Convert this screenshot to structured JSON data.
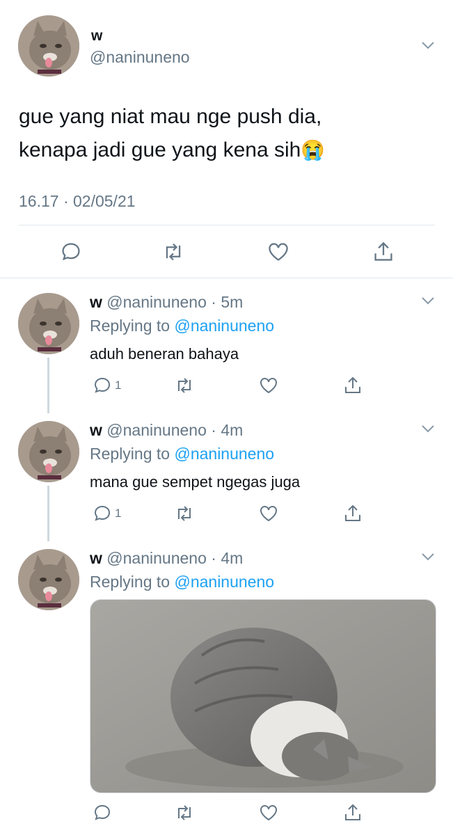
{
  "main_tweet": {
    "display_name": "w",
    "handle": "@naninuneno",
    "text_line1": "gue yang niat mau nge push dia,",
    "text_line2": "kenapa jadi gue yang kena sih",
    "emoji": "😭",
    "timestamp": "16.17 · 02/05/21"
  },
  "replies": [
    {
      "display_name": "w",
      "handle": "@naninuneno",
      "age": "· 5m",
      "replying_prefix": "Replying to",
      "replying_handle": "@naninuneno",
      "text": "aduh beneran bahaya",
      "reply_count": "1"
    },
    {
      "display_name": "w",
      "handle": "@naninuneno",
      "age": "· 4m",
      "replying_prefix": "Replying to",
      "replying_handle": "@naninuneno",
      "text": "mana gue sempet ngegas juga",
      "reply_count": "1"
    },
    {
      "display_name": "w",
      "handle": "@naninuneno",
      "age": "· 4m",
      "replying_prefix": "Replying to",
      "replying_handle": "@naninuneno",
      "media": "photo"
    }
  ],
  "icons": {
    "reply": "reply-icon",
    "retweet": "retweet-icon",
    "like": "heart-icon",
    "share": "share-icon",
    "menu": "chevron-down-icon"
  },
  "colors": {
    "accent": "#1da1f2",
    "muted": "#657786",
    "divider": "#e1e8ed"
  }
}
